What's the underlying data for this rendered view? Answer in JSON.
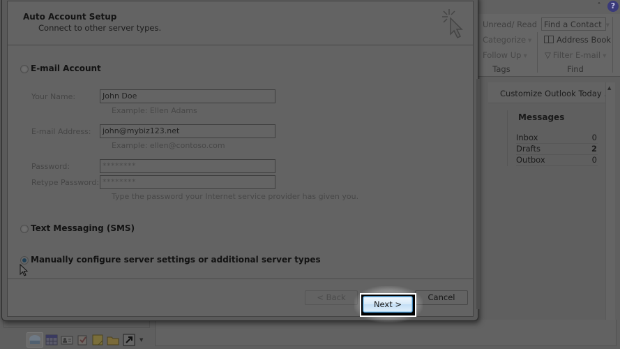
{
  "dialog": {
    "title": "Auto Account Setup",
    "subtitle": "Connect to other server types.",
    "options": {
      "email_account": {
        "label": "E-mail Account",
        "selected": false
      },
      "sms": {
        "label": "Text Messaging (SMS)",
        "selected": false
      },
      "manual": {
        "label": "Manually configure server settings or additional server types",
        "selected": true
      }
    },
    "fields": {
      "name": {
        "label": "Your Name:",
        "value": "John Doe",
        "hint": "Example: Ellen Adams"
      },
      "email": {
        "label": "E-mail Address:",
        "value": "john@mybiz123.net",
        "hint": "Example: ellen@contoso.com"
      },
      "password": {
        "label": "Password:",
        "value": "********"
      },
      "retype_password": {
        "label": "Retype Password:",
        "value": "********",
        "hint": "Type the password your Internet service provider has given you."
      }
    },
    "buttons": {
      "back": "< Back",
      "next": "Next >",
      "cancel": "Cancel"
    }
  },
  "ribbon": {
    "tags": {
      "unread_read": "Unread/ Read",
      "categorize": "Categorize",
      "follow_up": "Follow Up",
      "group_label": "Tags"
    },
    "find": {
      "find_contact": "Find a Contact",
      "address_book": "Address Book",
      "filter_email": "Filter E-mail",
      "group_label": "Find"
    },
    "help_glyph": "?",
    "collapse_glyph": "˄"
  },
  "outlook_today": {
    "customize_link": "Customize Outlook Today ...",
    "messages": {
      "title": "Messages",
      "rows": [
        {
          "label": "Inbox",
          "count": "0"
        },
        {
          "label": "Drafts",
          "count": "2",
          "bold": true
        },
        {
          "label": "Outbox",
          "count": "0"
        }
      ]
    }
  },
  "nav_bar": {
    "items": [
      "mail",
      "calendar",
      "contacts",
      "tasks",
      "notes",
      "folder-list",
      "shortcuts"
    ]
  }
}
